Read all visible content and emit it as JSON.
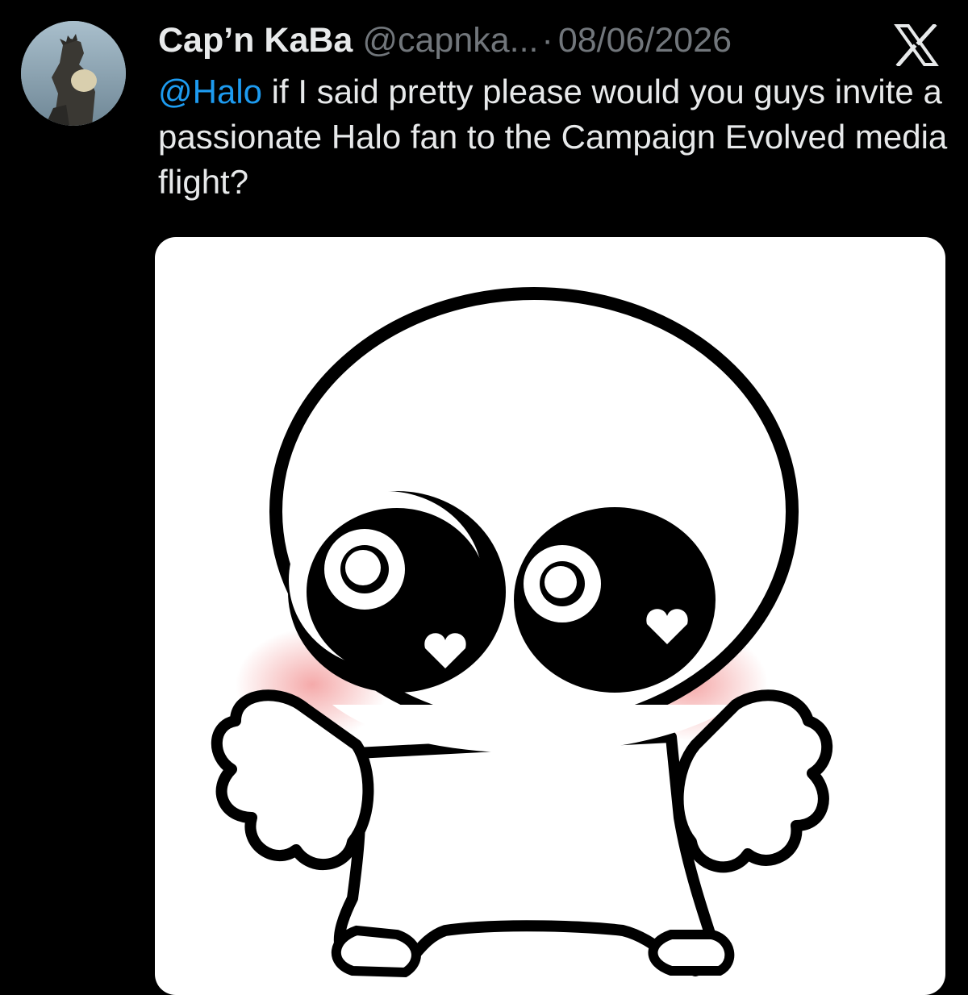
{
  "tweet": {
    "display_name": "Cap’n KaBa",
    "handle": "@capnka...",
    "separator": "·",
    "date": "08/06/2026",
    "mention": "@Halo",
    "text": " if I said pretty please would you guys invite a passionate Halo fan to the Campaign Evolved media flight?",
    "avatar_icon": "avatar-image",
    "platform_icon": "x-logo-icon",
    "media_icon": "cute-creature-illustration"
  },
  "colors": {
    "background": "#000000",
    "text": "#e7e9ea",
    "secondary": "#71767b",
    "link": "#1d9bf0",
    "blush": "#f4a5a5"
  }
}
